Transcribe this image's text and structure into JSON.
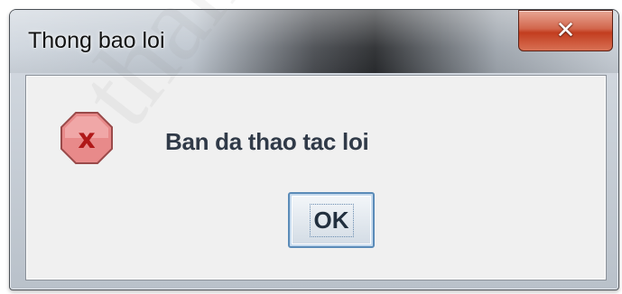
{
  "dialog": {
    "title": "Thong bao loi",
    "close_label": "✕",
    "message": "Ban da thao tac loi",
    "ok_label": "OK",
    "icon": "error-icon"
  },
  "watermark": {
    "text": "thancong"
  },
  "colors": {
    "close_button": "#c94a2c",
    "error_icon_fill": "#e88a8a",
    "error_icon_glyph": "#b01818",
    "message_text": "#303a48",
    "ok_border": "#5a8bb8"
  }
}
